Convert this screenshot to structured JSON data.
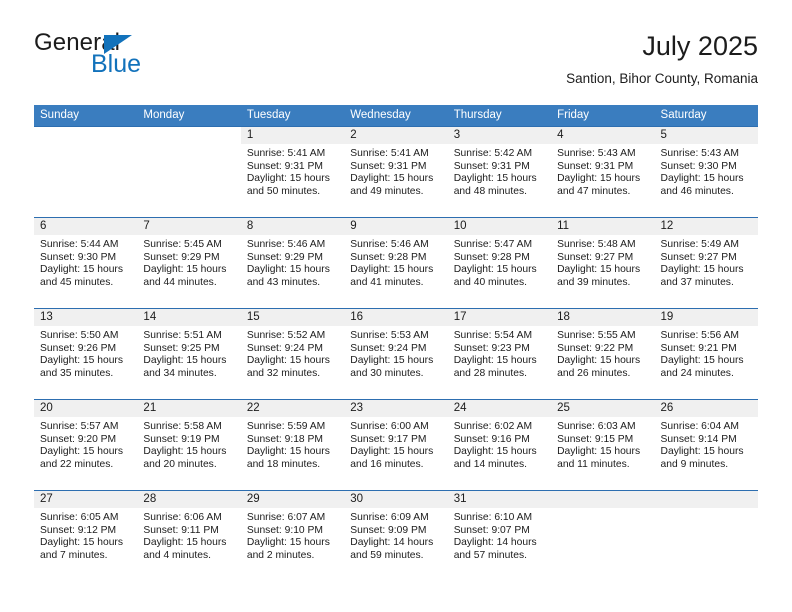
{
  "brand": {
    "name_top": "General",
    "name_bottom": "Blue",
    "accent_color": "#1272bb",
    "triangle_icon": "brand-triangle-icon"
  },
  "header": {
    "title": "July 2025",
    "subtitle": "Santion, Bihor County, Romania"
  },
  "theme": {
    "header_bg": "#3a7dbf",
    "header_text": "#ffffff",
    "row_rule": "#2d6eb0",
    "daynum_band": "#f0f0f0",
    "body_text": "#1c1c1c"
  },
  "weekday_headers": [
    "Sunday",
    "Monday",
    "Tuesday",
    "Wednesday",
    "Thursday",
    "Friday",
    "Saturday"
  ],
  "weeks": [
    [
      {
        "day": "",
        "blank": true,
        "sunrise": "",
        "sunset": "",
        "daylight_1": "",
        "daylight_2": ""
      },
      {
        "day": "",
        "blank": true,
        "sunrise": "",
        "sunset": "",
        "daylight_1": "",
        "daylight_2": ""
      },
      {
        "day": "1",
        "sunrise": "Sunrise: 5:41 AM",
        "sunset": "Sunset: 9:31 PM",
        "daylight_1": "Daylight: 15 hours",
        "daylight_2": "and 50 minutes."
      },
      {
        "day": "2",
        "sunrise": "Sunrise: 5:41 AM",
        "sunset": "Sunset: 9:31 PM",
        "daylight_1": "Daylight: 15 hours",
        "daylight_2": "and 49 minutes."
      },
      {
        "day": "3",
        "sunrise": "Sunrise: 5:42 AM",
        "sunset": "Sunset: 9:31 PM",
        "daylight_1": "Daylight: 15 hours",
        "daylight_2": "and 48 minutes."
      },
      {
        "day": "4",
        "sunrise": "Sunrise: 5:43 AM",
        "sunset": "Sunset: 9:31 PM",
        "daylight_1": "Daylight: 15 hours",
        "daylight_2": "and 47 minutes."
      },
      {
        "day": "5",
        "sunrise": "Sunrise: 5:43 AM",
        "sunset": "Sunset: 9:30 PM",
        "daylight_1": "Daylight: 15 hours",
        "daylight_2": "and 46 minutes."
      }
    ],
    [
      {
        "day": "6",
        "sunrise": "Sunrise: 5:44 AM",
        "sunset": "Sunset: 9:30 PM",
        "daylight_1": "Daylight: 15 hours",
        "daylight_2": "and 45 minutes."
      },
      {
        "day": "7",
        "sunrise": "Sunrise: 5:45 AM",
        "sunset": "Sunset: 9:29 PM",
        "daylight_1": "Daylight: 15 hours",
        "daylight_2": "and 44 minutes."
      },
      {
        "day": "8",
        "sunrise": "Sunrise: 5:46 AM",
        "sunset": "Sunset: 9:29 PM",
        "daylight_1": "Daylight: 15 hours",
        "daylight_2": "and 43 minutes."
      },
      {
        "day": "9",
        "sunrise": "Sunrise: 5:46 AM",
        "sunset": "Sunset: 9:28 PM",
        "daylight_1": "Daylight: 15 hours",
        "daylight_2": "and 41 minutes."
      },
      {
        "day": "10",
        "sunrise": "Sunrise: 5:47 AM",
        "sunset": "Sunset: 9:28 PM",
        "daylight_1": "Daylight: 15 hours",
        "daylight_2": "and 40 minutes."
      },
      {
        "day": "11",
        "sunrise": "Sunrise: 5:48 AM",
        "sunset": "Sunset: 9:27 PM",
        "daylight_1": "Daylight: 15 hours",
        "daylight_2": "and 39 minutes."
      },
      {
        "day": "12",
        "sunrise": "Sunrise: 5:49 AM",
        "sunset": "Sunset: 9:27 PM",
        "daylight_1": "Daylight: 15 hours",
        "daylight_2": "and 37 minutes."
      }
    ],
    [
      {
        "day": "13",
        "sunrise": "Sunrise: 5:50 AM",
        "sunset": "Sunset: 9:26 PM",
        "daylight_1": "Daylight: 15 hours",
        "daylight_2": "and 35 minutes."
      },
      {
        "day": "14",
        "sunrise": "Sunrise: 5:51 AM",
        "sunset": "Sunset: 9:25 PM",
        "daylight_1": "Daylight: 15 hours",
        "daylight_2": "and 34 minutes."
      },
      {
        "day": "15",
        "sunrise": "Sunrise: 5:52 AM",
        "sunset": "Sunset: 9:24 PM",
        "daylight_1": "Daylight: 15 hours",
        "daylight_2": "and 32 minutes."
      },
      {
        "day": "16",
        "sunrise": "Sunrise: 5:53 AM",
        "sunset": "Sunset: 9:24 PM",
        "daylight_1": "Daylight: 15 hours",
        "daylight_2": "and 30 minutes."
      },
      {
        "day": "17",
        "sunrise": "Sunrise: 5:54 AM",
        "sunset": "Sunset: 9:23 PM",
        "daylight_1": "Daylight: 15 hours",
        "daylight_2": "and 28 minutes."
      },
      {
        "day": "18",
        "sunrise": "Sunrise: 5:55 AM",
        "sunset": "Sunset: 9:22 PM",
        "daylight_1": "Daylight: 15 hours",
        "daylight_2": "and 26 minutes."
      },
      {
        "day": "19",
        "sunrise": "Sunrise: 5:56 AM",
        "sunset": "Sunset: 9:21 PM",
        "daylight_1": "Daylight: 15 hours",
        "daylight_2": "and 24 minutes."
      }
    ],
    [
      {
        "day": "20",
        "sunrise": "Sunrise: 5:57 AM",
        "sunset": "Sunset: 9:20 PM",
        "daylight_1": "Daylight: 15 hours",
        "daylight_2": "and 22 minutes."
      },
      {
        "day": "21",
        "sunrise": "Sunrise: 5:58 AM",
        "sunset": "Sunset: 9:19 PM",
        "daylight_1": "Daylight: 15 hours",
        "daylight_2": "and 20 minutes."
      },
      {
        "day": "22",
        "sunrise": "Sunrise: 5:59 AM",
        "sunset": "Sunset: 9:18 PM",
        "daylight_1": "Daylight: 15 hours",
        "daylight_2": "and 18 minutes."
      },
      {
        "day": "23",
        "sunrise": "Sunrise: 6:00 AM",
        "sunset": "Sunset: 9:17 PM",
        "daylight_1": "Daylight: 15 hours",
        "daylight_2": "and 16 minutes."
      },
      {
        "day": "24",
        "sunrise": "Sunrise: 6:02 AM",
        "sunset": "Sunset: 9:16 PM",
        "daylight_1": "Daylight: 15 hours",
        "daylight_2": "and 14 minutes."
      },
      {
        "day": "25",
        "sunrise": "Sunrise: 6:03 AM",
        "sunset": "Sunset: 9:15 PM",
        "daylight_1": "Daylight: 15 hours",
        "daylight_2": "and 11 minutes."
      },
      {
        "day": "26",
        "sunrise": "Sunrise: 6:04 AM",
        "sunset": "Sunset: 9:14 PM",
        "daylight_1": "Daylight: 15 hours",
        "daylight_2": "and 9 minutes."
      }
    ],
    [
      {
        "day": "27",
        "sunrise": "Sunrise: 6:05 AM",
        "sunset": "Sunset: 9:12 PM",
        "daylight_1": "Daylight: 15 hours",
        "daylight_2": "and 7 minutes."
      },
      {
        "day": "28",
        "sunrise": "Sunrise: 6:06 AM",
        "sunset": "Sunset: 9:11 PM",
        "daylight_1": "Daylight: 15 hours",
        "daylight_2": "and 4 minutes."
      },
      {
        "day": "29",
        "sunrise": "Sunrise: 6:07 AM",
        "sunset": "Sunset: 9:10 PM",
        "daylight_1": "Daylight: 15 hours",
        "daylight_2": "and 2 minutes."
      },
      {
        "day": "30",
        "sunrise": "Sunrise: 6:09 AM",
        "sunset": "Sunset: 9:09 PM",
        "daylight_1": "Daylight: 14 hours",
        "daylight_2": "and 59 minutes."
      },
      {
        "day": "31",
        "sunrise": "Sunrise: 6:10 AM",
        "sunset": "Sunset: 9:07 PM",
        "daylight_1": "Daylight: 14 hours",
        "daylight_2": "and 57 minutes."
      },
      {
        "day": "",
        "blank": false,
        "sunrise": "",
        "sunset": "",
        "daylight_1": "",
        "daylight_2": ""
      },
      {
        "day": "",
        "blank": false,
        "sunrise": "",
        "sunset": "",
        "daylight_1": "",
        "daylight_2": ""
      }
    ]
  ]
}
